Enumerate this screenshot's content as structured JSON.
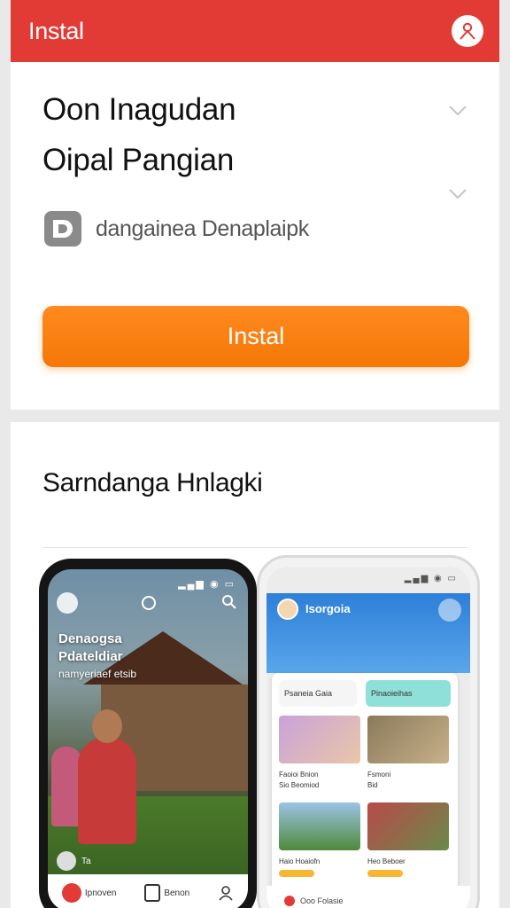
{
  "header": {
    "title": "Instal",
    "accent": "#e23b36"
  },
  "app": {
    "name_line1": "Oon Inagudan",
    "name_line2": "Oipal Pangian",
    "developer": "dangainea Denaplaipk",
    "install_label": "Instal",
    "install_color": "#f57707"
  },
  "screenshots": {
    "title": "Sarndanga Hnlagki",
    "phone1": {
      "heading1": "Denaogsa",
      "heading2": "Pdateldiar",
      "subtitle": "namyeriaef etsib",
      "chip_label": "Ta",
      "nav": [
        "Ipnoven",
        "Benon"
      ]
    },
    "phone2": {
      "header_title": "Isorgoia",
      "chip1": "Psaneia Gaia",
      "chip2": "Pinaoieihas",
      "cap1": "Faoioi Bnion",
      "cap1b": "Sio Beomiod",
      "cap2": "Fsmoni",
      "cap2b": "Bid",
      "cap3": "Haio Hoaiofn",
      "cap4": "Heo Beboer",
      "bottom": "Ooo Folasie"
    }
  }
}
